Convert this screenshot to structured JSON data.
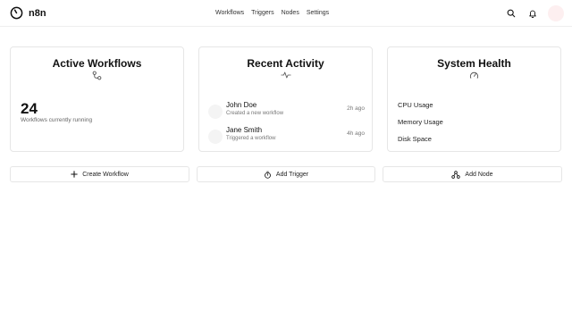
{
  "nav": {
    "brand": "n8n",
    "links": [
      "Workflows",
      "Triggers",
      "Nodes",
      "Settings"
    ]
  },
  "cards": {
    "active": {
      "title": "Active Workflows",
      "icon": "workflow-icon",
      "count": "24",
      "count_label": "Workflows currently running"
    },
    "activity": {
      "title": "Recent Activity",
      "icon": "activity-icon",
      "items": [
        {
          "name": "John Doe",
          "desc": "Created a new workflow",
          "time": "2h ago"
        },
        {
          "name": "Jane Smith",
          "desc": "Triggered a workflow",
          "time": "4h ago"
        }
      ]
    },
    "health": {
      "title": "System Health",
      "icon": "gauge-icon",
      "metrics": [
        "CPU Usage",
        "Memory Usage",
        "Disk Space"
      ]
    }
  },
  "actions": {
    "create_workflow": "Create Workflow",
    "add_trigger": "Add Trigger",
    "add_node": "Add Node"
  }
}
